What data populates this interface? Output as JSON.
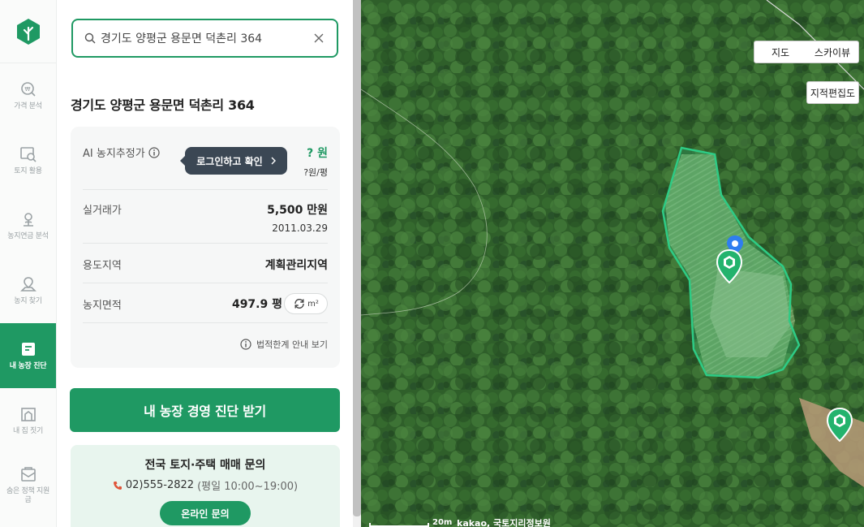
{
  "nav": {
    "items": [
      {
        "label": "가격 분석",
        "icon": "price-analysis-icon"
      },
      {
        "label": "토지 활용",
        "icon": "land-use-icon"
      },
      {
        "label": "농지연금 분석",
        "icon": "farmland-pension-icon"
      },
      {
        "label": "농지 찾기",
        "icon": "find-farmland-icon"
      },
      {
        "label": "내 농장 진단",
        "icon": "farm-diagnosis-icon"
      },
      {
        "label": "내 집 짓기",
        "icon": "build-house-icon"
      },
      {
        "label": "숨은 정책 지원금",
        "icon": "policy-subsidy-icon"
      }
    ],
    "active_index": 4,
    "accent": "#1f9963"
  },
  "search": {
    "value": "경기도 양평군 용문면 덕촌리 364"
  },
  "detail": {
    "address": "경기도 양평군 용문면 덕촌리 364",
    "ai_label": "AI 농지추정가",
    "login_tip": "로그인하고 확인",
    "ai_price": "? 원",
    "ai_unit_price": "?원/평",
    "deal_label": "실거래가",
    "deal_price": "5,500 만원",
    "deal_date": "2011.03.29",
    "zone_label": "용도지역",
    "zone_value": "계획관리지역",
    "area_label": "농지면적",
    "area_value": "497.9 평",
    "unit_toggle": "m²",
    "legal_link": "법적한계 안내 보기"
  },
  "cta": {
    "diagnosis_button": "내 농장 경영 진단 받기"
  },
  "inquiry": {
    "title": "전국 토지·주택 매매 문의",
    "phone": "02)555-2822",
    "hours": "(평일 10:00~19:00)",
    "button": "온라인 문의"
  },
  "map": {
    "type_map": "지도",
    "type_sky": "스카이뷰",
    "cadastral": "지적편집도",
    "scale": "20m",
    "copyright": "kakao, 국토지리정보원"
  }
}
